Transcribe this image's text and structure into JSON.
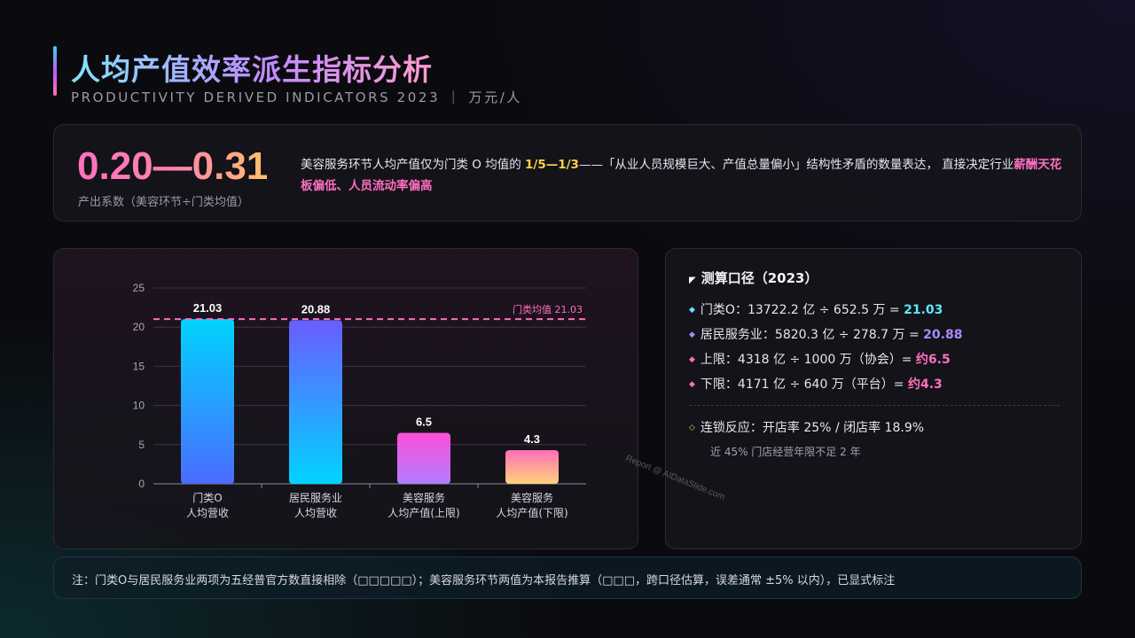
{
  "header": {
    "title": "人均产值效率派生指标分析",
    "subtitle": "PRODUCTIVITY DERIVED INDICATORS 2023 ｜ 万元/人"
  },
  "summary": {
    "big_number": "0.20—0.31",
    "big_caption": "产出系数（美容环节÷门类均值）",
    "desc_1": "美容服务环节人均产值仅为门类 O 均值的 ",
    "desc_hl_1": "1/5—1/3",
    "desc_2": "——「从业人员规模巨大、产值总量偏小」结构性矛盾的数量表达， 直接决定行业",
    "desc_hl_2": "薪酬天花板偏低、人员流动率偏高"
  },
  "chart_data": {
    "type": "bar",
    "categories": [
      [
        "门类O",
        "人均营收"
      ],
      [
        "居民服务业",
        "人均营收"
      ],
      [
        "美容服务",
        "人均产值(上限)"
      ],
      [
        "美容服务",
        "人均产值(下限)"
      ]
    ],
    "values": [
      21.03,
      20.88,
      6.5,
      4.3
    ],
    "value_labels": [
      "21.03",
      "20.88",
      "6.5",
      "4.3"
    ],
    "ylim": [
      0,
      25
    ],
    "yticks": [
      0,
      5,
      10,
      15,
      20,
      25
    ],
    "reference_line": {
      "value": 21.03,
      "label": "门类均值 21.03"
    },
    "bar_gradients": [
      [
        "#00d4ff",
        "#4a6cff"
      ],
      [
        "#6a5cff",
        "#00d4ff"
      ],
      [
        "#ff4fd8",
        "#b07cff"
      ],
      [
        "#ff6fb8",
        "#ffd27a"
      ]
    ],
    "grid": true,
    "title": "",
    "xlabel": "",
    "ylabel": ""
  },
  "calc": {
    "title": "测算口径（2023）",
    "rows": [
      {
        "text": "门类O：13722.2 亿 ÷ 652.5 万 = ",
        "value": "21.03",
        "color": "#5ee6ff",
        "dot_color": "#5ee6ff"
      },
      {
        "text": "居民服务业：5820.3 亿 ÷ 278.7 万 = ",
        "value": "20.88",
        "color": "#a98bff",
        "dot_color": "#a98bff"
      },
      {
        "text": "上限：4318 亿 ÷ 1000 万（协会）= ",
        "value": "约6.5",
        "color": "#ff6fc0",
        "dot_color": "#ff6fc0"
      },
      {
        "text": "下限：4171 亿 ÷ 640 万（平台）= ",
        "value": "约4.3",
        "color": "#ff6fc0",
        "dot_color": "#ff6fc0"
      }
    ],
    "chain": "连锁反应：开店率 25% / 闭店率 18.9%",
    "chain_sub": "近 45% 门店经营年限不足 2 年"
  },
  "watermark": "Report @ AIDataSlide.com",
  "note": "注：门类O与居民服务业两项为五经普官方数直接相除（□□□□□）；美容服务环节两值为本报告推算（□□□，跨口径估算，误差通常 ±5% 以内），已显式标注"
}
